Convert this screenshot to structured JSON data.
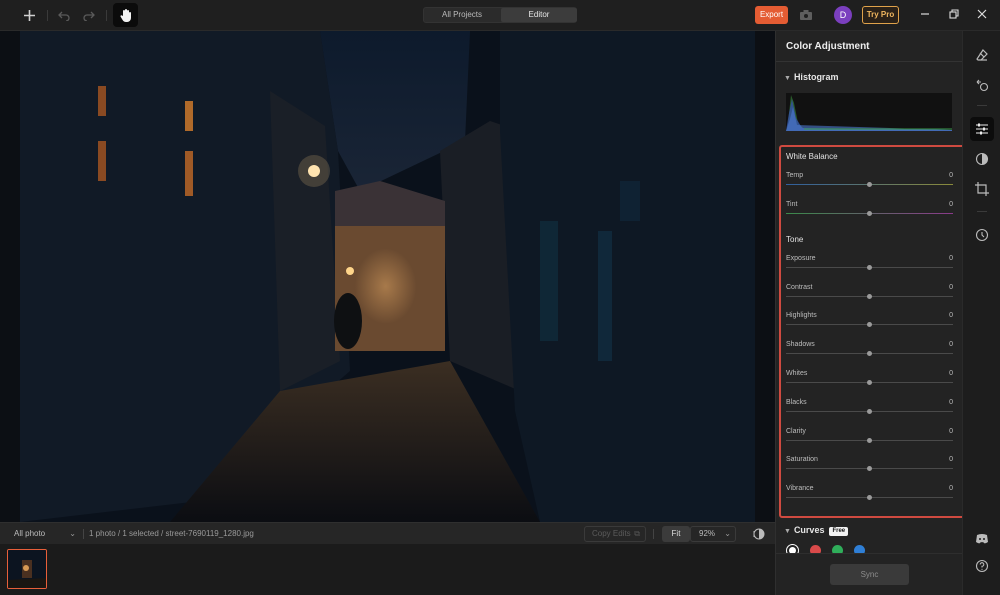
{
  "topbar": {
    "tabs": [
      {
        "label": "All Projects",
        "active": false
      },
      {
        "label": "Editor",
        "active": true
      }
    ],
    "export_label": "Export",
    "avatar_initial": "D",
    "trypro_label": "Try Pro",
    "colors": {
      "export": "#e45c33",
      "avatar": "#7b3fbf",
      "trypro": "#e0a24a"
    }
  },
  "statusbar": {
    "album_select": "All photo",
    "info": "1 photo / 1 selected / street-7690119_1280.jpg",
    "copy_edits_label": "Copy Edits",
    "fit_label": "Fit",
    "zoom_value": "92%"
  },
  "panel": {
    "title": "Color Adjustment",
    "histogram_title": "Histogram",
    "white_balance": {
      "title": "White Balance",
      "sliders": [
        {
          "label": "Temp",
          "value": "0"
        },
        {
          "label": "Tint",
          "value": "0"
        }
      ]
    },
    "tone": {
      "title": "Tone",
      "sliders": [
        {
          "label": "Exposure",
          "value": "0"
        },
        {
          "label": "Contrast",
          "value": "0"
        },
        {
          "label": "Highlights",
          "value": "0"
        },
        {
          "label": "Shadows",
          "value": "0"
        },
        {
          "label": "Whites",
          "value": "0"
        },
        {
          "label": "Blacks",
          "value": "0"
        },
        {
          "label": "Clarity",
          "value": "0"
        },
        {
          "label": "Saturation",
          "value": "0"
        },
        {
          "label": "Vibrance",
          "value": "0"
        }
      ]
    },
    "curves": {
      "title": "Curves",
      "badge": "Free",
      "channels": [
        {
          "name": "rgb-channel",
          "color": "#ffffff"
        },
        {
          "name": "red-channel",
          "color": "#d94a4a"
        },
        {
          "name": "green-channel",
          "color": "#2fae5a"
        },
        {
          "name": "blue-channel",
          "color": "#2f7fd6"
        }
      ]
    },
    "sync_label": "Sync",
    "highlight_color": "#cf4a40"
  },
  "right_toolbar": {
    "icons": [
      "eraser-icon",
      "ai-removal-icon",
      "color-adjustment-icon",
      "mask-icon",
      "crop-icon",
      "history-icon",
      "discord-icon",
      "help-icon"
    ]
  }
}
